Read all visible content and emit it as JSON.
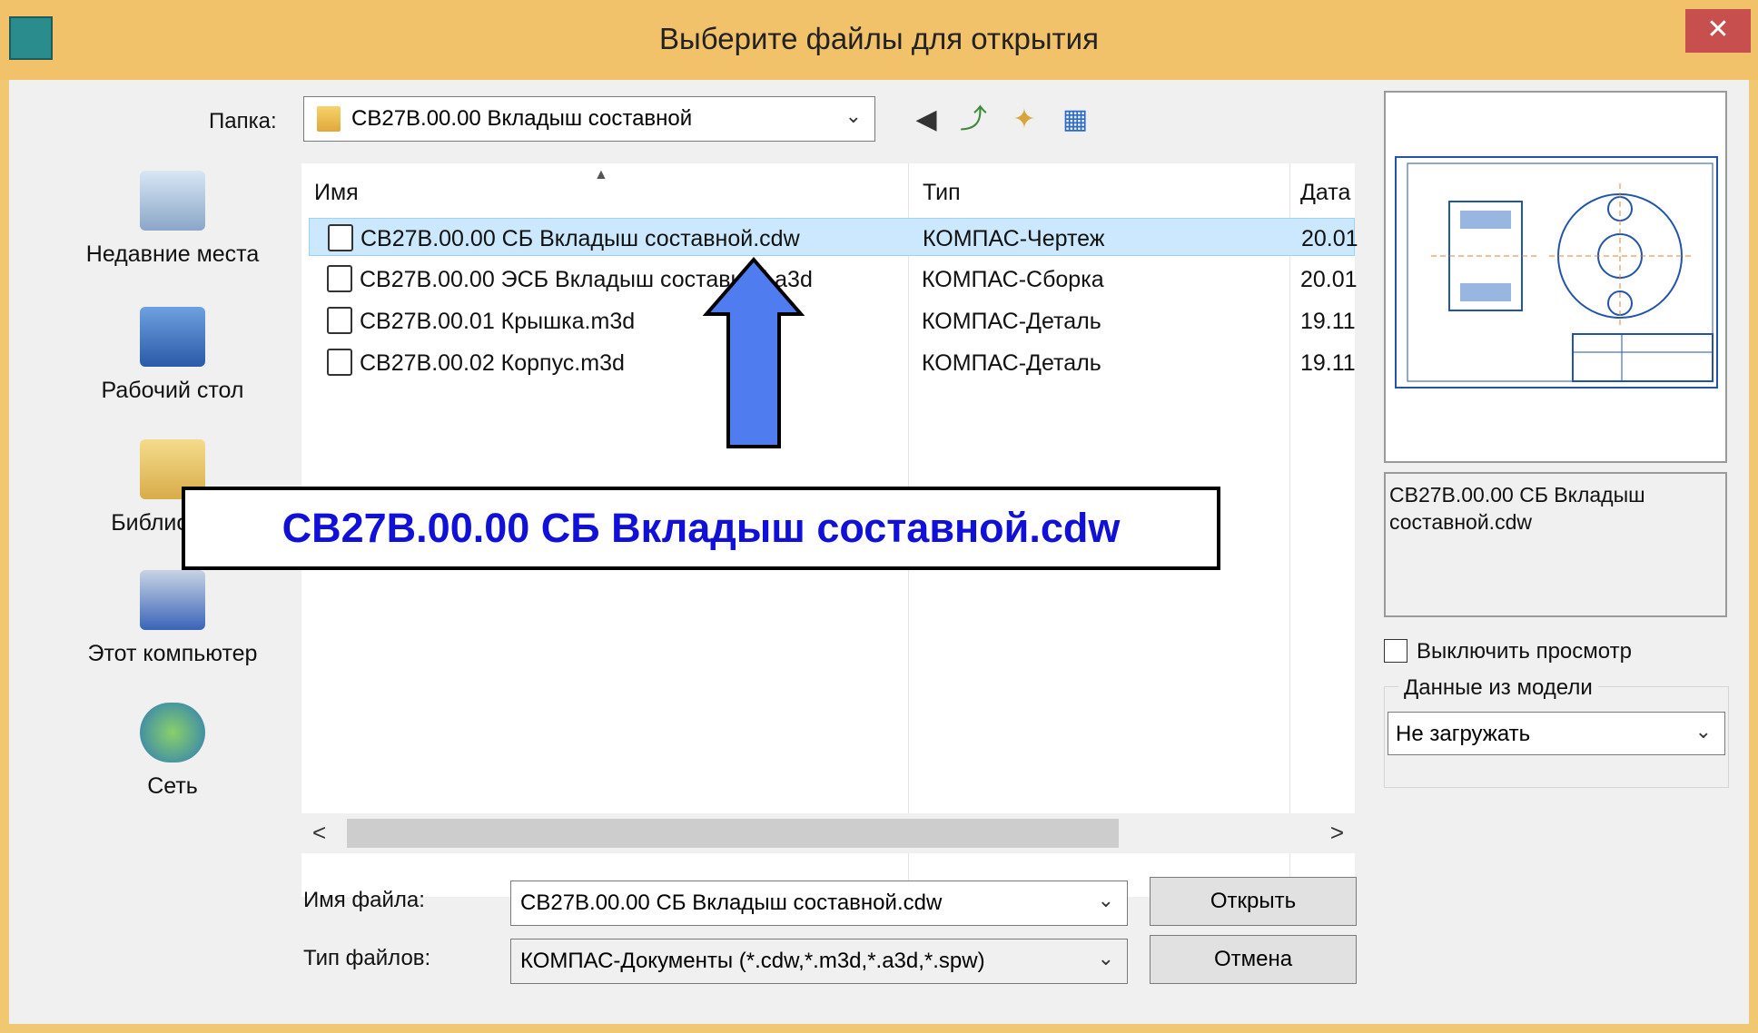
{
  "window": {
    "title": "Выберите файлы для открытия",
    "close_label": "✕"
  },
  "toolbar": {
    "folder_label": "Папка:",
    "folder_value": "СВ27В.00.00 Вкладыш составной",
    "icons": [
      "back-icon",
      "up-folder-icon",
      "new-folder-icon",
      "view-menu-icon"
    ]
  },
  "places": [
    {
      "label": "Недавние места",
      "icon": "recent-places-icon"
    },
    {
      "label": "Рабочий стол",
      "icon": "desktop-icon"
    },
    {
      "label": "Библиотеки",
      "icon": "libraries-icon"
    },
    {
      "label": "Этот компьютер",
      "icon": "computer-icon"
    },
    {
      "label": "Сеть",
      "icon": "network-icon"
    }
  ],
  "filelist": {
    "columns": [
      "Имя",
      "Тип",
      "Дата"
    ],
    "rows": [
      {
        "name": "СВ27В.00.00 СБ Вкладыш составной.cdw",
        "type": "КОМПАС-Чертеж",
        "date": "20.01",
        "selected": true
      },
      {
        "name": "СВ27В.00.00 ЭСБ Вкладыш составной.a3d",
        "type": "КОМПАС-Сборка",
        "date": "20.01",
        "selected": false
      },
      {
        "name": "СВ27В.00.01 Крышка.m3d",
        "type": "КОМПАС-Деталь",
        "date": "19.11",
        "selected": false
      },
      {
        "name": "СВ27В.00.02 Корпус.m3d",
        "type": "КОМПАС-Деталь",
        "date": "19.11",
        "selected": false
      }
    ]
  },
  "scroll": {
    "left": "<",
    "right": ">"
  },
  "bottom": {
    "filename_label": "Имя файла:",
    "filename_value": "СВ27В.00.00 СБ Вкладыш составной.cdw",
    "filetype_label": "Тип файлов:",
    "filetype_value": "КОМПАС-Документы (*.cdw,*.m3d,*.a3d,*.spw)",
    "open_button": "Открыть",
    "cancel_button": "Отмена"
  },
  "preview": {
    "filename": "СВ27В.00.00 СБ Вкладыш составной.cdw",
    "disable_preview_label": "Выключить просмотр",
    "disable_preview_checked": false,
    "model_data_label": "Данные из модели",
    "model_data_value": "Не загружать"
  },
  "annotation": {
    "callout_text": "СВ27В.00.00 СБ Вкладыш составной.cdw",
    "arrow_color": "#4f7df0"
  },
  "colors": {
    "title_bar": "#f2c26a",
    "close_button": "#c7504f",
    "selection": "#cce8ff",
    "callout_text": "#1010d8"
  }
}
